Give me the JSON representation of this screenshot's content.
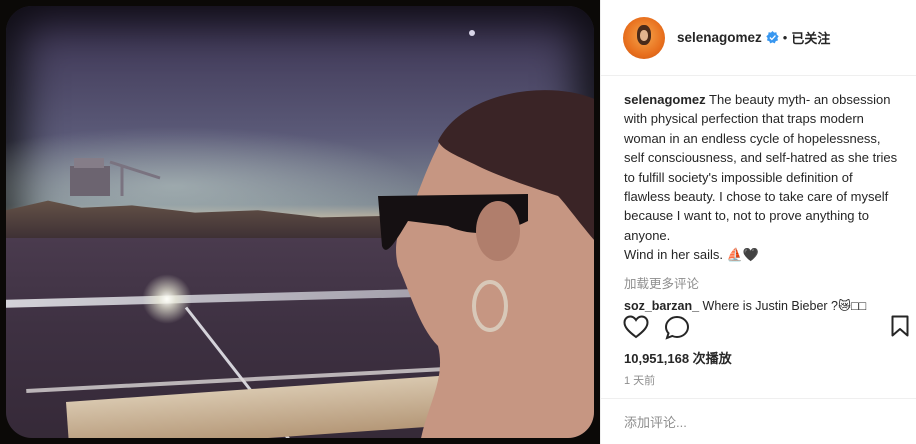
{
  "post": {
    "image_alt": "",
    "header": {
      "username": "selenagomez",
      "verified_icon": "verified-badge-icon",
      "dot": "•",
      "follow_status": "已关注"
    },
    "caption": {
      "author": "selenagomez",
      "text": "The beauty myth- an obsession with physical perfection that traps modern woman in an endless cycle of hopelessness, self consciousness, and self-hatred as she tries to fulfill society's impossible definition of flawless beauty. I chose to take care of myself because I want to, not to prove anything to anyone.",
      "text2": "Wind in her sails. ⛵🖤"
    },
    "load_more": "加载更多评论",
    "comments": [
      {
        "author": "soz_barzan_",
        "text": "Where is Justin Bieber ?😿□□"
      }
    ],
    "actions": {
      "like_icon": "heart-icon",
      "comment_icon": "comment-bubble-icon",
      "save_icon": "bookmark-icon"
    },
    "views": "10,951,168 次播放",
    "timestamp": "1 天前",
    "comment_placeholder": "添加评论..."
  },
  "colors": {
    "text": "#262626",
    "muted": "#8e8e8e",
    "verified": "#3897f0",
    "divider": "#efefef"
  }
}
